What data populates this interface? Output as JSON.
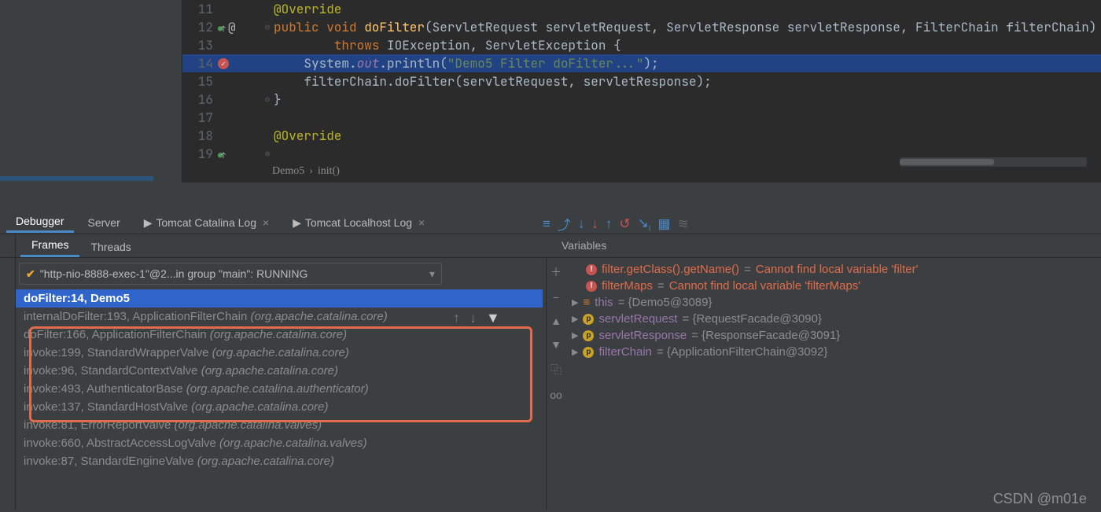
{
  "editor": {
    "lines": [
      {
        "num": "11",
        "icon": "",
        "fold": "",
        "html": "<span class='ann'>@Override</span>"
      },
      {
        "num": "12",
        "icon": "override",
        "at": "@",
        "fold": "⊖",
        "html": "<span class='kw'>public void </span><span class='fn'>doFilter</span><span class='pln'>(ServletRequest servletRequest, ServletResponse servletResponse, FilterChain filterChain)</span>"
      },
      {
        "num": "13",
        "icon": "",
        "fold": "",
        "html": "        <span class='kw'>throws </span><span class='pln'>IOException, ServletException {</span>"
      },
      {
        "num": "14",
        "icon": "breakpoint",
        "fold": "",
        "hl": true,
        "html": "    <span class='pln'>System.</span><span class='fld'>out</span><span class='pln'>.println(</span><span class='str'>\"Demo5 Filter doFilter...\"</span><span class='pln'>);</span>"
      },
      {
        "num": "15",
        "icon": "",
        "fold": "",
        "html": "    <span class='pln'>filterChain.doFilter(servletRequest, servletResponse);</span>"
      },
      {
        "num": "16",
        "icon": "",
        "fold": "⊖",
        "html": "<span class='pln'>}</span>"
      },
      {
        "num": "17",
        "icon": "",
        "fold": "",
        "html": ""
      },
      {
        "num": "18",
        "icon": "",
        "fold": "",
        "html": "<span class='ann'>@Override</span>"
      },
      {
        "num": "19",
        "icon": "override",
        "fold": "⊕",
        "html": ""
      }
    ],
    "breadcrumb": [
      "Demo5",
      "init()"
    ]
  },
  "debug": {
    "tabs": [
      {
        "label": "Debugger",
        "active": true
      },
      {
        "label": "Server",
        "active": false
      },
      {
        "label": "Tomcat Catalina Log",
        "active": false,
        "closeable": true,
        "icon": true
      },
      {
        "label": "Tomcat Localhost Log",
        "active": false,
        "closeable": true,
        "icon": true
      }
    ],
    "subtabs": [
      {
        "label": "Frames",
        "active": true
      },
      {
        "label": "Threads",
        "active": false
      }
    ],
    "vars_title": "Variables",
    "thread": "\"http-nio-8888-exec-1\"@2...in group \"main\": RUNNING",
    "frames": [
      {
        "text": "doFilter:14, Demo5",
        "sel": true
      },
      {
        "text": "internalDoFilter:193, ApplicationFilterChain ",
        "pkg": "(org.apache.catalina.core)"
      },
      {
        "text": "doFilter:166, ApplicationFilterChain ",
        "pkg": "(org.apache.catalina.core)"
      },
      {
        "text": "invoke:199, StandardWrapperValve ",
        "pkg": "(org.apache.catalina.core)"
      },
      {
        "text": "invoke:96, StandardContextValve ",
        "pkg": "(org.apache.catalina.core)"
      },
      {
        "text": "invoke:493, AuthenticatorBase ",
        "pkg": "(org.apache.catalina.authenticator)"
      },
      {
        "text": "invoke:137, StandardHostValve ",
        "pkg": "(org.apache.catalina.core)"
      },
      {
        "text": "invoke:81, ErrorReportValve ",
        "pkg": "(org.apache.catalina.valves)"
      },
      {
        "text": "invoke:660, AbstractAccessLogValve ",
        "pkg": "(org.apache.catalina.valves)"
      },
      {
        "text": "invoke:87, StandardEngineValve ",
        "pkg": "(org.apache.catalina.core)"
      }
    ],
    "variables": [
      {
        "kind": "err",
        "name": "filter.getClass().getName()",
        "val": "Cannot find local variable 'filter'"
      },
      {
        "kind": "err",
        "name": "filterMaps",
        "val": "Cannot find local variable 'filterMaps'"
      },
      {
        "kind": "this",
        "name": "this",
        "val": "{Demo5@3089}"
      },
      {
        "kind": "param",
        "name": "servletRequest",
        "val": "{RequestFacade@3090}"
      },
      {
        "kind": "param",
        "name": "servletResponse",
        "val": "{ResponseFacade@3091}"
      },
      {
        "kind": "param",
        "name": "filterChain",
        "val": "{ApplicationFilterChain@3092}"
      }
    ]
  },
  "watermark": "CSDN @m01e"
}
